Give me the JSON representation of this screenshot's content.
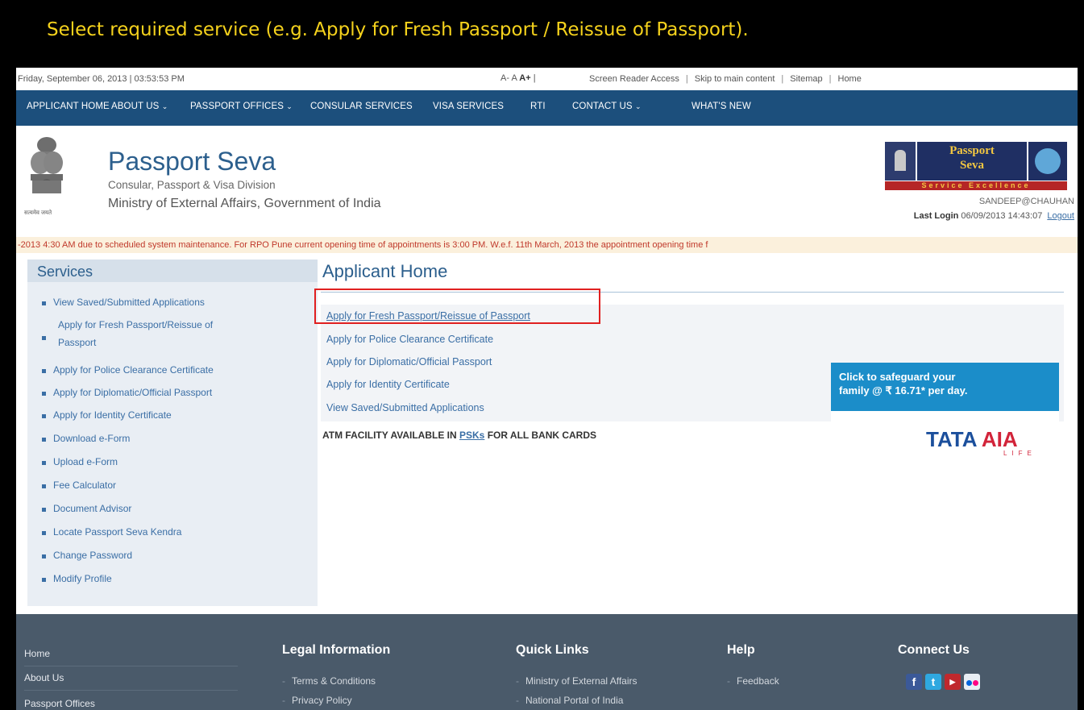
{
  "banner": {
    "text": "Select required service (e.g. Apply for Fresh Passport / Reissue of Passport)."
  },
  "topbar": {
    "date": "Friday, September 06, 2013 | 03:53:53 PM",
    "font_small": "A-",
    "font_normal": "A",
    "font_large": "A+",
    "font_sep": "|",
    "links": [
      "Screen Reader Access",
      "Skip to main content",
      "Sitemap",
      "Home"
    ]
  },
  "nav": {
    "items": [
      {
        "label": "APPLICANT HOME",
        "caret": ""
      },
      {
        "label": "ABOUT US",
        "caret": "⌄"
      },
      {
        "label": "PASSPORT OFFICES",
        "caret": "⌄"
      },
      {
        "label": "CONSULAR SERVICES",
        "caret": ""
      },
      {
        "label": "VISA SERVICES",
        "caret": ""
      },
      {
        "label": "RTI",
        "caret": ""
      },
      {
        "label": "CONTACT US",
        "caret": "⌄"
      },
      {
        "label": "WHAT'S NEW",
        "caret": ""
      }
    ]
  },
  "header": {
    "title": "Passport Seva",
    "subtitle1": "Consular, Passport & Visa Division",
    "subtitle2": "Ministry of External Affairs, Government of India",
    "emblem_caption": "सत्यमेव जयते",
    "brand_line1": "Passport",
    "brand_line2": "Seva",
    "brand_tagline": "Service Excellence",
    "user": "SANDEEP@CHAUHAN",
    "last_login_label": "Last Login",
    "last_login_value": "06/09/2013 14:43:07",
    "logout": "Logout"
  },
  "ticker": {
    "text": "-2013 4:30 AM due to scheduled system maintenance. For RPO Pune current opening time of appointments is 3:00 PM. W.e.f. 11th March, 2013 the appointment opening time f"
  },
  "sidebar": {
    "title": "Services",
    "items": [
      "View Saved/Submitted Applications",
      "Apply for Fresh Passport/Reissue of",
      "Passport",
      "Apply for Police Clearance Certificate",
      "Apply for Diplomatic/Official Passport",
      "Apply for Identity Certificate",
      "Download e-Form",
      "Upload e-Form",
      "Fee Calculator",
      "Document Advisor",
      "Locate Passport Seva Kendra",
      "Change Password",
      "Modify Profile"
    ]
  },
  "content": {
    "title": "Applicant Home",
    "links": [
      "Apply for Fresh Passport/Reissue of Passport",
      "Apply for Police Clearance Certificate",
      "Apply for Diplomatic/Official Passport",
      "Apply for Identity Certificate",
      "View Saved/Submitted Applications"
    ],
    "atm_prefix": "ATM FACILITY AVAILABLE IN ",
    "atm_link": "PSKs",
    "atm_suffix": " FOR ALL BANK CARDS"
  },
  "ad": {
    "line1": "Click to safeguard your",
    "line2": "family @ ₹ 16.71* per day.",
    "brand_a": "TATA",
    "brand_b": "AIA",
    "life": "LIFE"
  },
  "footer": {
    "left_links": [
      "Home",
      "About Us",
      "Passport Offices"
    ],
    "legal": {
      "title": "Legal Information",
      "items": [
        "Terms & Conditions",
        "Privacy Policy"
      ]
    },
    "quick": {
      "title": "Quick Links",
      "items": [
        "Ministry of External Affairs",
        "National Portal of India"
      ]
    },
    "help": {
      "title": "Help",
      "items": [
        "Feedback"
      ]
    },
    "connect": {
      "title": "Connect Us",
      "icons": [
        "facebook-icon",
        "twitter-icon",
        "youtube-icon",
        "flickr-icon"
      ]
    }
  },
  "colors": {
    "nav": "#1c4f7c",
    "link": "#3a6ea5",
    "banner_text": "#f5d21c",
    "highlight": "#e02020",
    "footer": "#4a5a6a"
  }
}
